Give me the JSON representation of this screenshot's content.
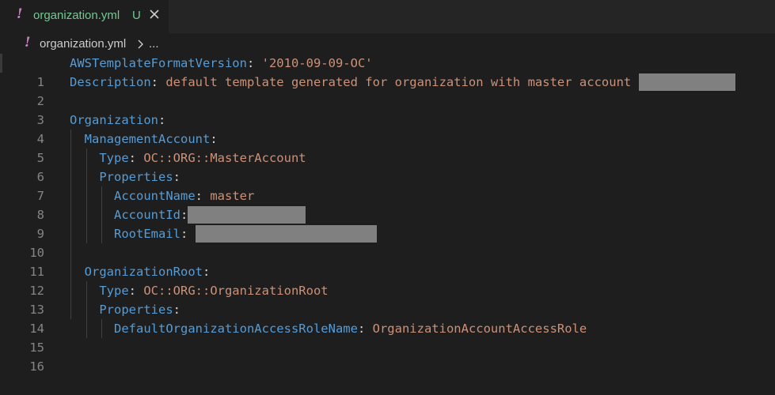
{
  "tab": {
    "filename": "organization.yml",
    "status": "U",
    "file_icon": "yaml-exclamation-icon",
    "close_icon": "close-icon"
  },
  "breadcrumb": {
    "file": "organization.yml",
    "separator_icon": "chevron-right-icon",
    "more": "..."
  },
  "editor": {
    "lines": [
      {
        "n": "1",
        "key": "AWSTemplateFormatVersion",
        "value": "'2010-09-09-OC'"
      },
      {
        "n": "2",
        "key": "Description",
        "value": "default template generated for organization with master account"
      },
      {
        "n": "3"
      },
      {
        "n": "4",
        "key": "Organization"
      },
      {
        "n": "5",
        "key": "ManagementAccount"
      },
      {
        "n": "6",
        "key": "Type",
        "value": "OC::ORG::MasterAccount"
      },
      {
        "n": "7",
        "key": "Properties"
      },
      {
        "n": "8",
        "key": "AccountName",
        "value": "master"
      },
      {
        "n": "9",
        "key": "AccountId"
      },
      {
        "n": "10",
        "key": "RootEmail"
      },
      {
        "n": "11"
      },
      {
        "n": "12",
        "key": "OrganizationRoot"
      },
      {
        "n": "13",
        "key": "Type",
        "value": "OC::ORG::OrganizationRoot"
      },
      {
        "n": "14",
        "key": "Properties"
      },
      {
        "n": "15",
        "key": "DefaultOrganizationAccessRoleName",
        "value": "OrganizationAccountAccessRole"
      },
      {
        "n": "16"
      }
    ],
    "colors": {
      "key": "#569cd6",
      "string": "#ce9178",
      "punctuation": "#d4d4d4",
      "line_number": "#858585",
      "background": "#1e1e1e",
      "redaction": "#808080"
    }
  }
}
